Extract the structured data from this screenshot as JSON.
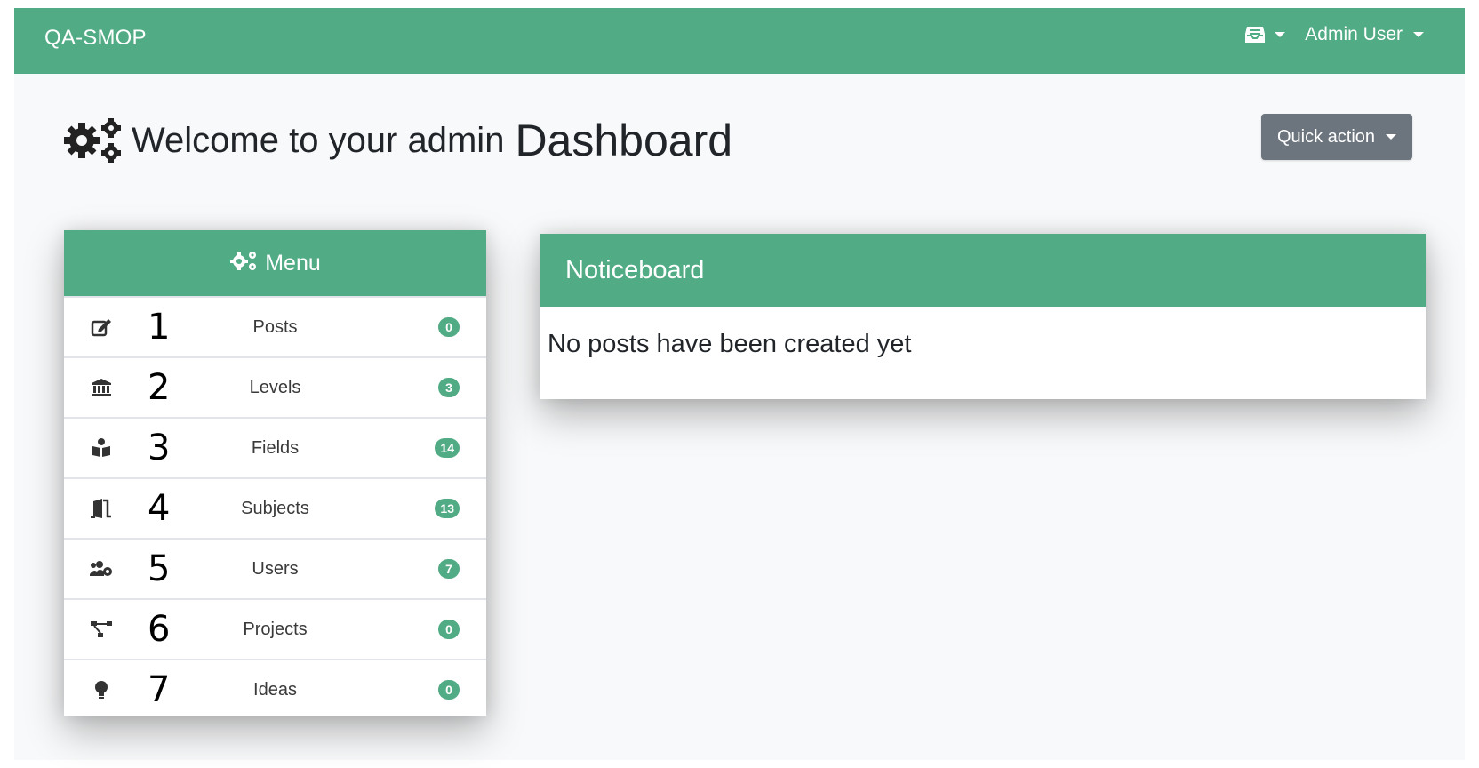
{
  "navbar": {
    "brand": "QA-SMOP",
    "inbox_icon": "inbox-icon",
    "user_name": "Admin User"
  },
  "page": {
    "title_prefix": "Welcome to your admin",
    "title_main": "Dashboard",
    "title_icon": "gears-icon",
    "quick_action_label": "Quick action"
  },
  "menu": {
    "title": "Menu",
    "items": [
      {
        "number": "1",
        "label": "Posts",
        "count": "0",
        "icon": "edit-icon"
      },
      {
        "number": "2",
        "label": "Levels",
        "count": "3",
        "icon": "institution-icon"
      },
      {
        "number": "3",
        "label": "Fields",
        "count": "14",
        "icon": "book-reader-icon"
      },
      {
        "number": "4",
        "label": "Subjects",
        "count": "13",
        "icon": "door-icon"
      },
      {
        "number": "5",
        "label": "Users",
        "count": "7",
        "icon": "users-cog-icon"
      },
      {
        "number": "6",
        "label": "Projects",
        "count": "0",
        "icon": "project-diagram-icon"
      },
      {
        "number": "7",
        "label": "Ideas",
        "count": "0",
        "icon": "lightbulb-icon"
      }
    ]
  },
  "noticeboard": {
    "title": "Noticeboard",
    "empty_message": "No posts have been created yet"
  },
  "colors": {
    "primary": "#51ab84",
    "secondary": "#6c757d",
    "background": "#f8f9fa"
  }
}
